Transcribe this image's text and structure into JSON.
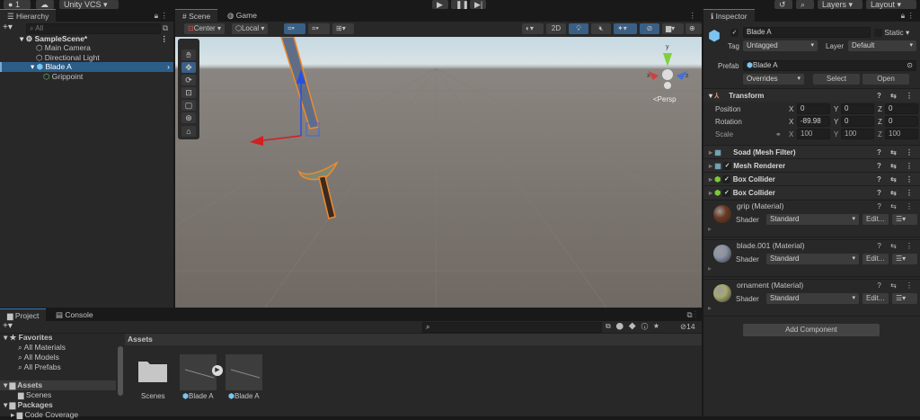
{
  "topbar": {
    "account": "1",
    "vcs": "Unity VCS",
    "layers": "Layers",
    "layout": "Layout"
  },
  "hierarchy": {
    "title": "Hierarchy",
    "search_placeholder": "All",
    "items": [
      {
        "label": "SampleScene*"
      },
      {
        "label": "Main Camera"
      },
      {
        "label": "Directional Light"
      },
      {
        "label": "Blade A"
      },
      {
        "label": "Grippoint"
      }
    ]
  },
  "scene": {
    "tabs": [
      {
        "label": "Scene"
      },
      {
        "label": "Game"
      }
    ],
    "pivot": "Center",
    "space": "Local",
    "mode_2d": "2D",
    "persp": "Persp",
    "axis_x": "x",
    "axis_y": "y",
    "axis_z": "z"
  },
  "inspector": {
    "title": "Inspector",
    "name": "Blade A",
    "static": "Static",
    "tag_label": "Tag",
    "tag": "Untagged",
    "layer_label": "Layer",
    "layer": "Default",
    "prefab_label": "Prefab",
    "prefab": "Blade A",
    "overrides": "Overrides",
    "select": "Select",
    "open": "Open",
    "transform": {
      "title": "Transform",
      "position": "Position",
      "rotation": "Rotation",
      "scale": "Scale",
      "pos": [
        "0",
        "0",
        "0"
      ],
      "rot": [
        "-89.98",
        "0",
        "0"
      ],
      "scl": [
        "100",
        "100",
        "100"
      ],
      "x": "X",
      "y": "Y",
      "z": "Z"
    },
    "components": [
      {
        "label": "Soad (Mesh Filter)"
      },
      {
        "label": "Mesh Renderer"
      },
      {
        "label": "Box Collider"
      },
      {
        "label": "Box Collider"
      }
    ],
    "materials": [
      {
        "name": "grip (Material)",
        "color": "#6b3a22"
      },
      {
        "name": "blade.001 (Material)",
        "color": "#8a92a4"
      },
      {
        "name": "ornament (Material)",
        "color": "#a8a870"
      }
    ],
    "shader_label": "Shader",
    "shader": "Standard",
    "edit": "Edit...",
    "add_component": "Add Component"
  },
  "project": {
    "tabs": [
      {
        "label": "Project"
      },
      {
        "label": "Console"
      }
    ],
    "favorites": "Favorites",
    "fav_items": [
      "All Materials",
      "All Models",
      "All Prefabs"
    ],
    "assets": "Assets",
    "scenes": "Scenes",
    "packages": "Packages",
    "code_coverage": "Code Coverage",
    "breadcrumb": "Assets",
    "hidden_count": "14",
    "grid": [
      {
        "label": "Scenes"
      },
      {
        "label": "Blade A"
      },
      {
        "label": "Blade A"
      }
    ]
  }
}
